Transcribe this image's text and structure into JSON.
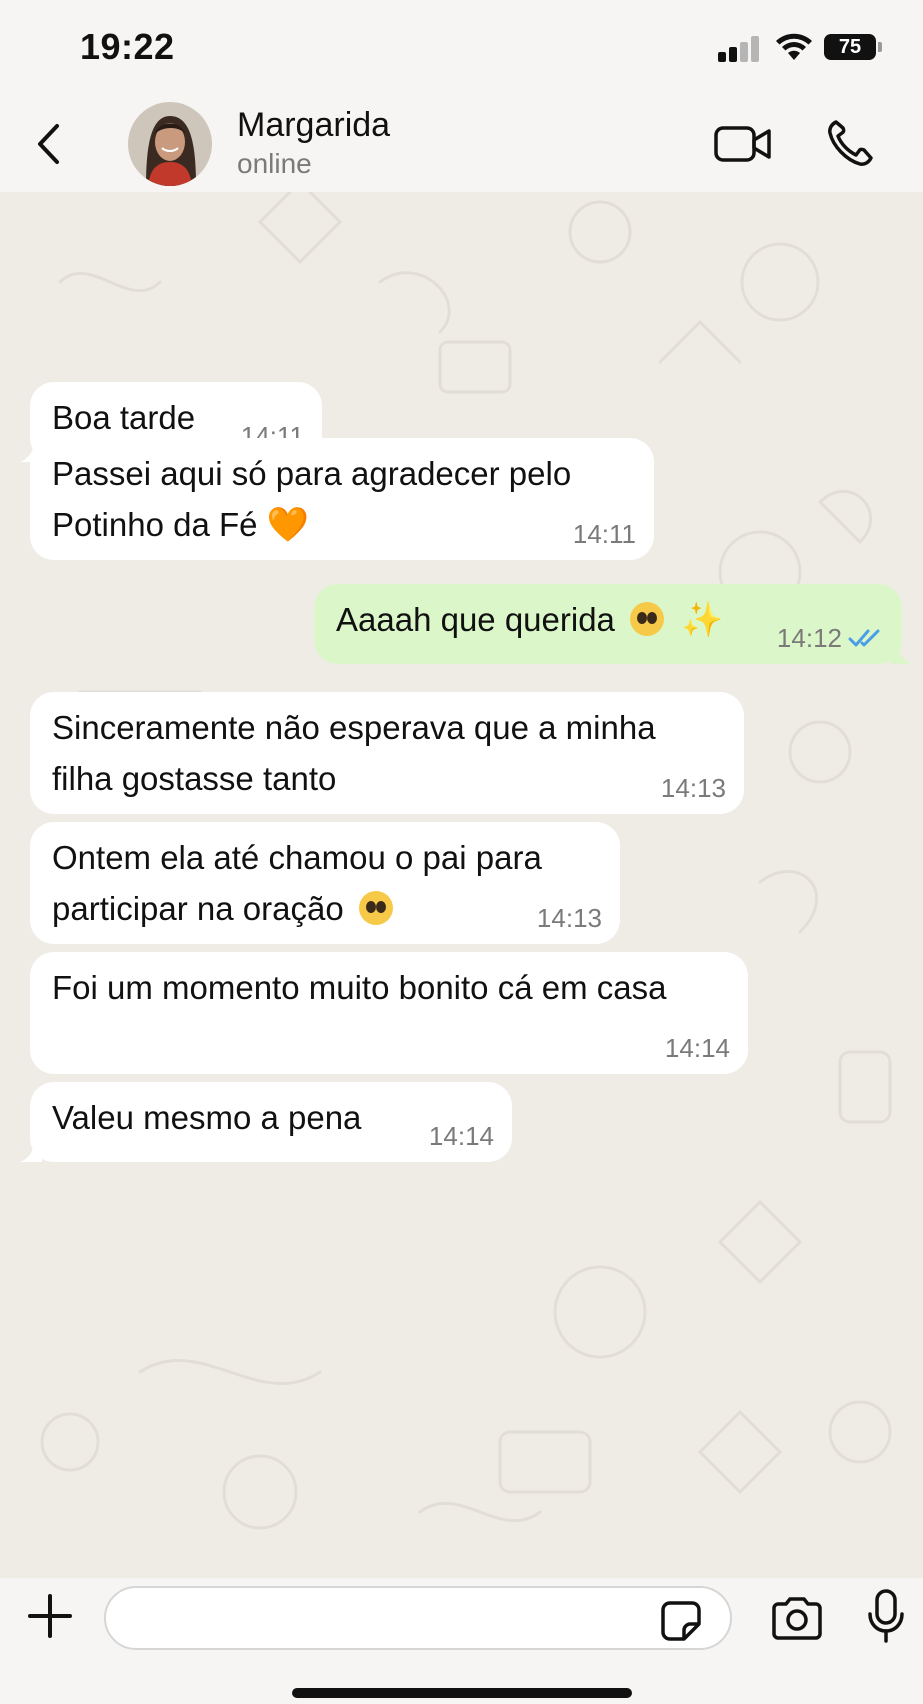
{
  "status_bar": {
    "time": "19:22",
    "battery": "75"
  },
  "header": {
    "contact_name": "Margarida",
    "contact_status": "online"
  },
  "messages": [
    {
      "direction": "in",
      "text": "Boa tarde",
      "time": "14:11"
    },
    {
      "direction": "in",
      "text_line1": "Passei aqui só para agradecer pelo",
      "text_line2": "Potinho da Fé",
      "emoji": "🧡",
      "time": "14:11"
    },
    {
      "direction": "out",
      "text": "Aaaah que querida",
      "emoji": "✨",
      "time": "14:12",
      "status": "read"
    },
    {
      "direction": "in",
      "text_line1": "Sinceramente não esperava que a minha",
      "text_line2": "filha gostasse tanto",
      "time": "14:13"
    },
    {
      "direction": "in",
      "text_line1": "Ontem ela até chamou o pai para",
      "text_line2": "participar na oração",
      "time": "14:13"
    },
    {
      "direction": "in",
      "text": "Foi um momento muito bonito cá em casa",
      "time": "14:14"
    },
    {
      "direction": "in",
      "text": "Valeu mesmo a pena",
      "time": "14:14"
    }
  ],
  "input": {
    "placeholder": ""
  },
  "colors": {
    "incoming_bubble": "#ffffff",
    "outgoing_bubble": "#dbf7c9",
    "read_ticks": "#4a9ee8",
    "chat_background": "#efece6"
  },
  "icons": [
    "back-arrow-icon",
    "video-call-icon",
    "phone-call-icon",
    "plus-icon",
    "sticker-icon",
    "camera-icon",
    "microphone-icon",
    "double-check-icon"
  ]
}
